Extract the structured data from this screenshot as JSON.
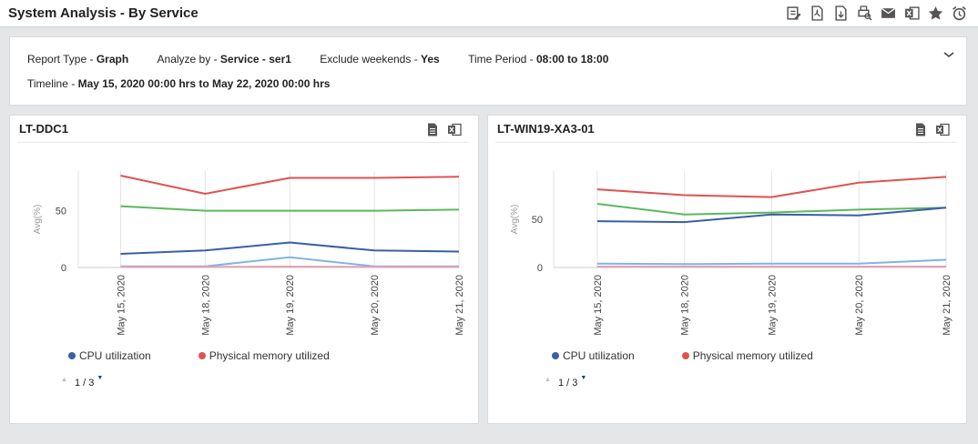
{
  "header": {
    "title": "System Analysis - By Service"
  },
  "filters": {
    "report_type_label": "Report Type - ",
    "report_type_value": "Graph",
    "analyze_by_label": "Analyze by - ",
    "analyze_by_value": "Service - ser1",
    "exclude_weekends_label": "Exclude weekends - ",
    "exclude_weekends_value": "Yes",
    "time_period_label": "Time Period - ",
    "time_period_value": "08:00 to 18:00",
    "timeline_label": "Timeline - ",
    "timeline_value": "May 15, 2020 00:00 hrs to May 22, 2020 00:00 hrs"
  },
  "colors": {
    "cpu": "#3a5ea8",
    "memory": "#e05252",
    "green": "#5cb85c",
    "lightblue": "#7fb3e8",
    "pink": "#e6a0b4"
  },
  "panels": [
    {
      "title": "LT-DDC1",
      "legend": [
        "CPU utilization",
        "Physical memory utilized"
      ],
      "pager": "1 / 3"
    },
    {
      "title": "LT-WIN19-XA3-01",
      "legend": [
        "CPU utilization",
        "Physical memory utilized"
      ],
      "pager": "1 / 3"
    }
  ],
  "chart_data": [
    {
      "type": "line",
      "x": [
        "May 15, 2020",
        "May 18, 2020",
        "May 19, 2020",
        "May 20, 2020",
        "May 21, 2020"
      ],
      "ylabel": "Avg(%)",
      "yticks": [
        0,
        50
      ],
      "ylim": [
        0,
        85
      ],
      "series": [
        {
          "name": "Physical memory utilized",
          "color": "#e05252",
          "values": [
            81,
            65,
            79,
            79,
            80
          ]
        },
        {
          "color": "#5cb85c",
          "values": [
            54,
            50,
            50,
            50,
            51
          ]
        },
        {
          "name": "CPU utilization",
          "color": "#3a5ea8",
          "values": [
            12,
            15,
            22,
            15,
            14
          ]
        },
        {
          "color": "#7fb3e8",
          "values": [
            1,
            1,
            9,
            1,
            1
          ]
        },
        {
          "color": "#e6a0b4",
          "values": [
            0.5,
            0.5,
            0.8,
            0.5,
            0.5
          ]
        }
      ]
    },
    {
      "type": "line",
      "x": [
        "May 15, 2020",
        "May 18, 2020",
        "May 19, 2020",
        "May 20, 2020",
        "May 21, 2020"
      ],
      "ylabel": "Avg(%)",
      "yticks": [
        0,
        50
      ],
      "ylim": [
        0,
        100
      ],
      "series": [
        {
          "name": "Physical memory utilized",
          "color": "#e05252",
          "values": [
            81,
            75,
            73,
            88,
            94
          ]
        },
        {
          "color": "#5cb85c",
          "values": [
            66,
            55,
            57,
            60,
            62
          ]
        },
        {
          "name": "CPU utilization",
          "color": "#3a5ea8",
          "values": [
            48,
            47,
            55,
            54,
            62
          ]
        },
        {
          "color": "#7fb3e8",
          "values": [
            4,
            3.5,
            4,
            4,
            8
          ]
        },
        {
          "color": "#e6a0b4",
          "values": [
            1,
            1,
            1,
            1,
            1
          ]
        }
      ]
    }
  ]
}
